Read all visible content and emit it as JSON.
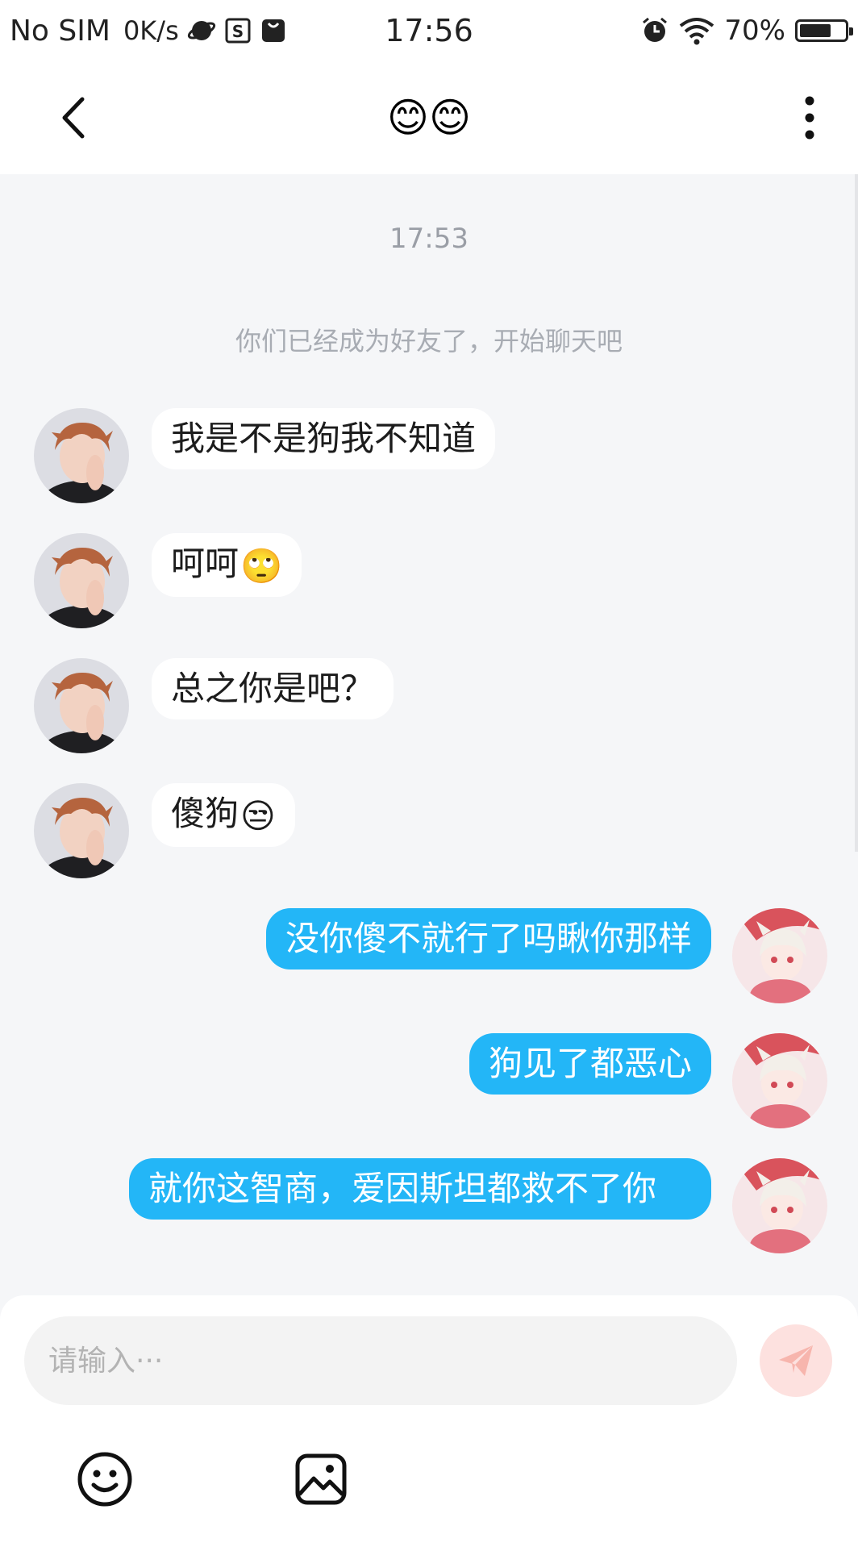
{
  "status_bar": {
    "carrier": "No SIM",
    "speed": "0K/s",
    "time": "17:56",
    "battery": "70%",
    "battery_level": 0.7,
    "icons": [
      "planet-icon",
      "s-app-icon",
      "shopping-bag-icon",
      "alarm-icon",
      "wifi-icon",
      "battery-icon"
    ]
  },
  "nav": {
    "title": "😊😊",
    "back_icon": "chevron-left-icon",
    "more_icon": "more-vertical-icon"
  },
  "chat": {
    "timestamp": "17:53",
    "system_note": "你们已经成为好友了，开始聊天吧",
    "messages": [
      {
        "side": "left",
        "text": "我是不是狗我不知道",
        "emoji": ""
      },
      {
        "side": "left",
        "text": "呵呵",
        "emoji": "🙄"
      },
      {
        "side": "left",
        "text": "总之你是吧？",
        "emoji": ""
      },
      {
        "side": "left",
        "text": "傻狗",
        "emoji": "😒"
      },
      {
        "side": "right",
        "text": "没你傻不就行了吗瞅你那样",
        "emoji": ""
      },
      {
        "side": "right",
        "text": "狗见了都恶心",
        "emoji": ""
      },
      {
        "side": "right",
        "text": "就你这智商，爱因斯坦都救不了你",
        "emoji": ""
      }
    ]
  },
  "input": {
    "placeholder": "请输入···",
    "value": "",
    "send_icon": "send-icon",
    "tools": [
      "emoji-icon",
      "image-icon"
    ]
  },
  "colors": {
    "outgoing_bubble": "#23b6f7",
    "incoming_bubble": "#ffffff",
    "chat_background": "#f5f6f8",
    "send_button": "#fde1df",
    "send_icon": "#f7b5ad"
  }
}
